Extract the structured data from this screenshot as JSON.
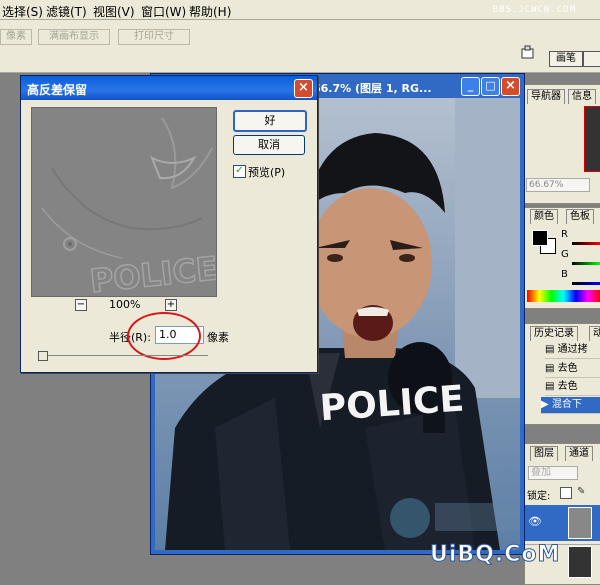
{
  "menubar": {
    "items": [
      "选择(S)",
      "滤镜(T)",
      "视图(V)",
      "窗口(W)",
      "帮助(H)"
    ],
    "watermark": "BBS.JCWCN.COM"
  },
  "optionsbar": {
    "buttons": [
      "像素",
      "满画布显示",
      "打印尺寸"
    ],
    "palette_tab": "画笔"
  },
  "document": {
    "title": "66.7% (图层 1, RG...",
    "photo_text": "POLICE"
  },
  "dialog": {
    "title": "高反差保留",
    "ok_label": "好",
    "cancel_label": "取消",
    "preview_label": "预览(P)",
    "preview_checked": true,
    "zoom_text": "100%",
    "preview_text": "POLICE",
    "radius_label": "半径(R):",
    "radius_value": "1.0",
    "radius_unit": "像素"
  },
  "navigator": {
    "tabs": [
      "导航器",
      "信息"
    ],
    "zoom": "66.67%"
  },
  "colors": {
    "tabs": [
      "颜色",
      "色板"
    ],
    "channels": [
      "R",
      "G",
      "B"
    ]
  },
  "history": {
    "tabs": [
      "历史记录",
      "动"
    ],
    "items": [
      "通过拷",
      "去色",
      "去色",
      "混合下"
    ]
  },
  "layers": {
    "tabs": [
      "图层",
      "通道"
    ],
    "blend": "叠加",
    "lock_label": "锁定:"
  },
  "watermark_bottom": "UiBQ.CoM",
  "accent_colors": {
    "title_blue": "#0a5fd8",
    "highlight_red": "#d8171b",
    "selected": "#316ac5"
  }
}
